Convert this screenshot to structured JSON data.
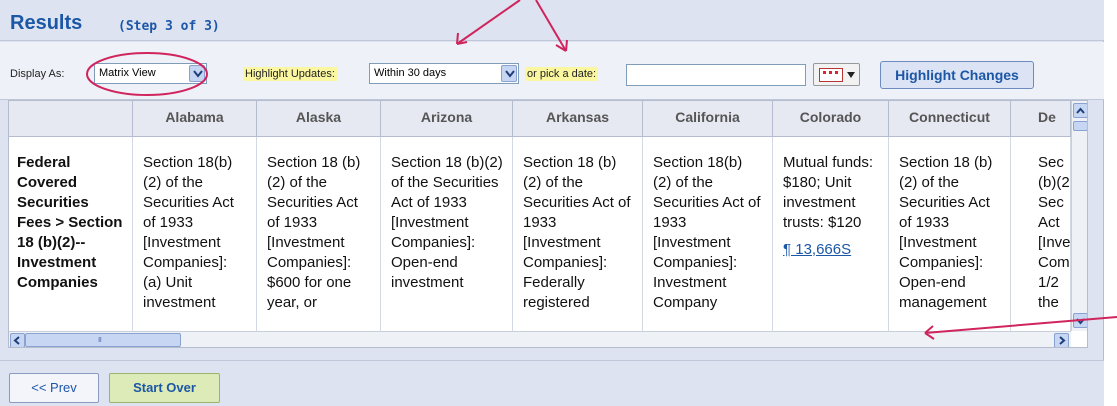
{
  "header": {
    "title": "Results",
    "step": "(Step 3 of 3)"
  },
  "toolbar": {
    "display_as_label": "Display As:",
    "display_as_value": "Matrix View",
    "highlight_label": "Highlight Updates:",
    "highlight_value": "Within 30 days",
    "date_label": "or pick a date:",
    "date_value": "",
    "highlight_button": "Highlight Changes"
  },
  "table": {
    "columns": [
      "",
      "Alabama",
      "Alaska",
      "Arizona",
      "Arkansas",
      "California",
      "Colorado",
      "Connecticut",
      "De"
    ],
    "row_header": "Federal Covered Securities Fees > Section 18 (b)(2)-- Investment Companies",
    "cells": [
      "Section 18(b) (2) of the Securities Act of 1933 [Investment Companies]: (a) Unit investment",
      "Section 18 (b)(2) of the Securities Act of 1933 [Investment Companies]: $600 for one year, or",
      "Section 18 (b)(2) of the Securities Act of 1933 [Investment Companies]: Open-end investment",
      "Section 18 (b)(2) of the Securities Act of 1933 [Investment Companies]: Federally registered",
      "Section 18(b) (2) of the Securities Act of 1933 [Investment Companies]: Investment Company",
      "Mutual funds: $180; Unit investment trusts: $120",
      "Section 18 (b)(2) of the Securities Act of 1933 [Investment Companies]: Open-end management",
      "Sec (b)(2 Sec Act [Inve Com 1/2 the"
    ],
    "colorado_link": "¶ 13,666S"
  },
  "scrollbar": {
    "thumb_grip": "III"
  },
  "footer": {
    "prev": "<< Prev",
    "start_over": "Start Over"
  },
  "colors": {
    "title_blue": "#1c57a6",
    "highlight_yellow": "#fbf7a0",
    "annotation_red": "#d0245d",
    "start_over_green": "#dcebb8"
  }
}
